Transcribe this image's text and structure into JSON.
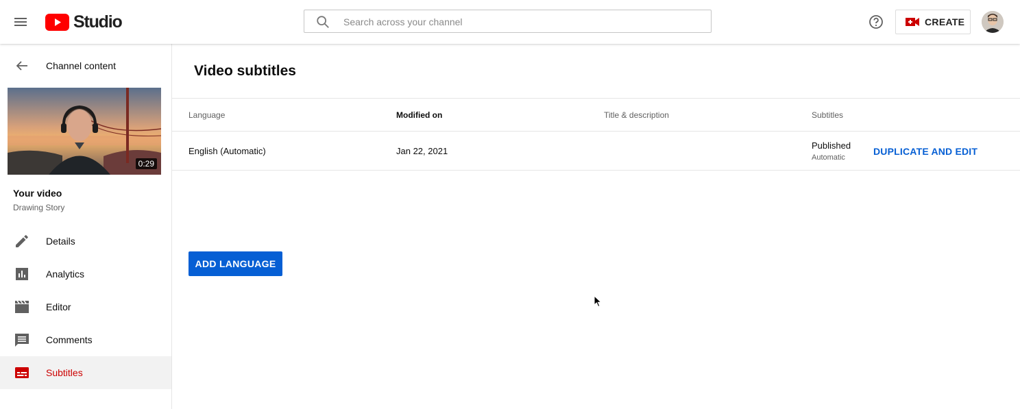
{
  "app": {
    "logo_text": "Studio",
    "brand_color": "#ff0000",
    "accent_color": "#065fd4"
  },
  "topbar": {
    "search_placeholder": "Search across your channel",
    "create_label": "CREATE",
    "icons": [
      "menu-icon",
      "search-icon",
      "help-icon",
      "video-camera-icon",
      "avatar"
    ]
  },
  "sidebar": {
    "back_label": "Channel content",
    "video": {
      "duration": "0:29",
      "title": "Your video",
      "channel": "Drawing Story"
    },
    "items": [
      {
        "label": "Details",
        "icon": "pencil-icon",
        "active": false
      },
      {
        "label": "Analytics",
        "icon": "analytics-icon",
        "active": false
      },
      {
        "label": "Editor",
        "icon": "clapperboard-icon",
        "active": false
      },
      {
        "label": "Comments",
        "icon": "comment-icon",
        "active": false
      },
      {
        "label": "Subtitles",
        "icon": "subtitles-icon",
        "active": true
      }
    ],
    "active_color": "#cc0000"
  },
  "main": {
    "title": "Video subtitles",
    "columns": [
      "Language",
      "Modified on",
      "Title & description",
      "Subtitles"
    ],
    "rows": [
      {
        "language": "English (Automatic)",
        "modified": "Jan 22, 2021",
        "title_desc": "",
        "subtitles_status": "Published",
        "subtitles_sub": "Automatic",
        "action": "DUPLICATE AND EDIT"
      }
    ],
    "add_language_label": "ADD LANGUAGE"
  }
}
